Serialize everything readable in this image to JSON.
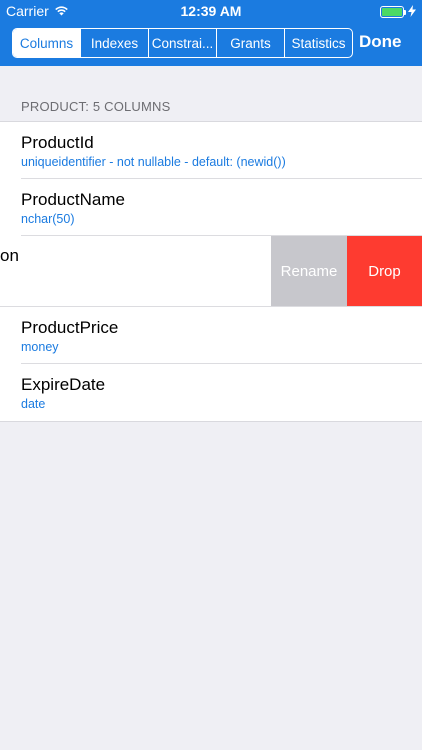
{
  "status": {
    "carrier": "Carrier",
    "time": "12:39 AM"
  },
  "tabs": [
    {
      "label": "Columns"
    },
    {
      "label": "Indexes"
    },
    {
      "label": "Constrai..."
    },
    {
      "label": "Grants"
    },
    {
      "label": "Statistics"
    }
  ],
  "active_tab": "Columns",
  "done_label": "Done",
  "section_header": "PRODUCT: 5 COLUMNS",
  "rows": [
    {
      "title": "ProductId",
      "subtitle": "uniqueidentifier - not nullable - default: (newid())"
    },
    {
      "title": "ProductName",
      "subtitle": "nchar(50)"
    },
    {
      "title": "on",
      "subtitle": ""
    },
    {
      "title": "ProductPrice",
      "subtitle": "money"
    },
    {
      "title": "ExpireDate",
      "subtitle": "date"
    }
  ],
  "swipe_actions": {
    "rename": "Rename",
    "drop": "Drop"
  },
  "colors": {
    "accent": "#1b7be0",
    "drop": "#fe3b30",
    "rename": "#c7c7cc",
    "battery": "#4cd964"
  }
}
